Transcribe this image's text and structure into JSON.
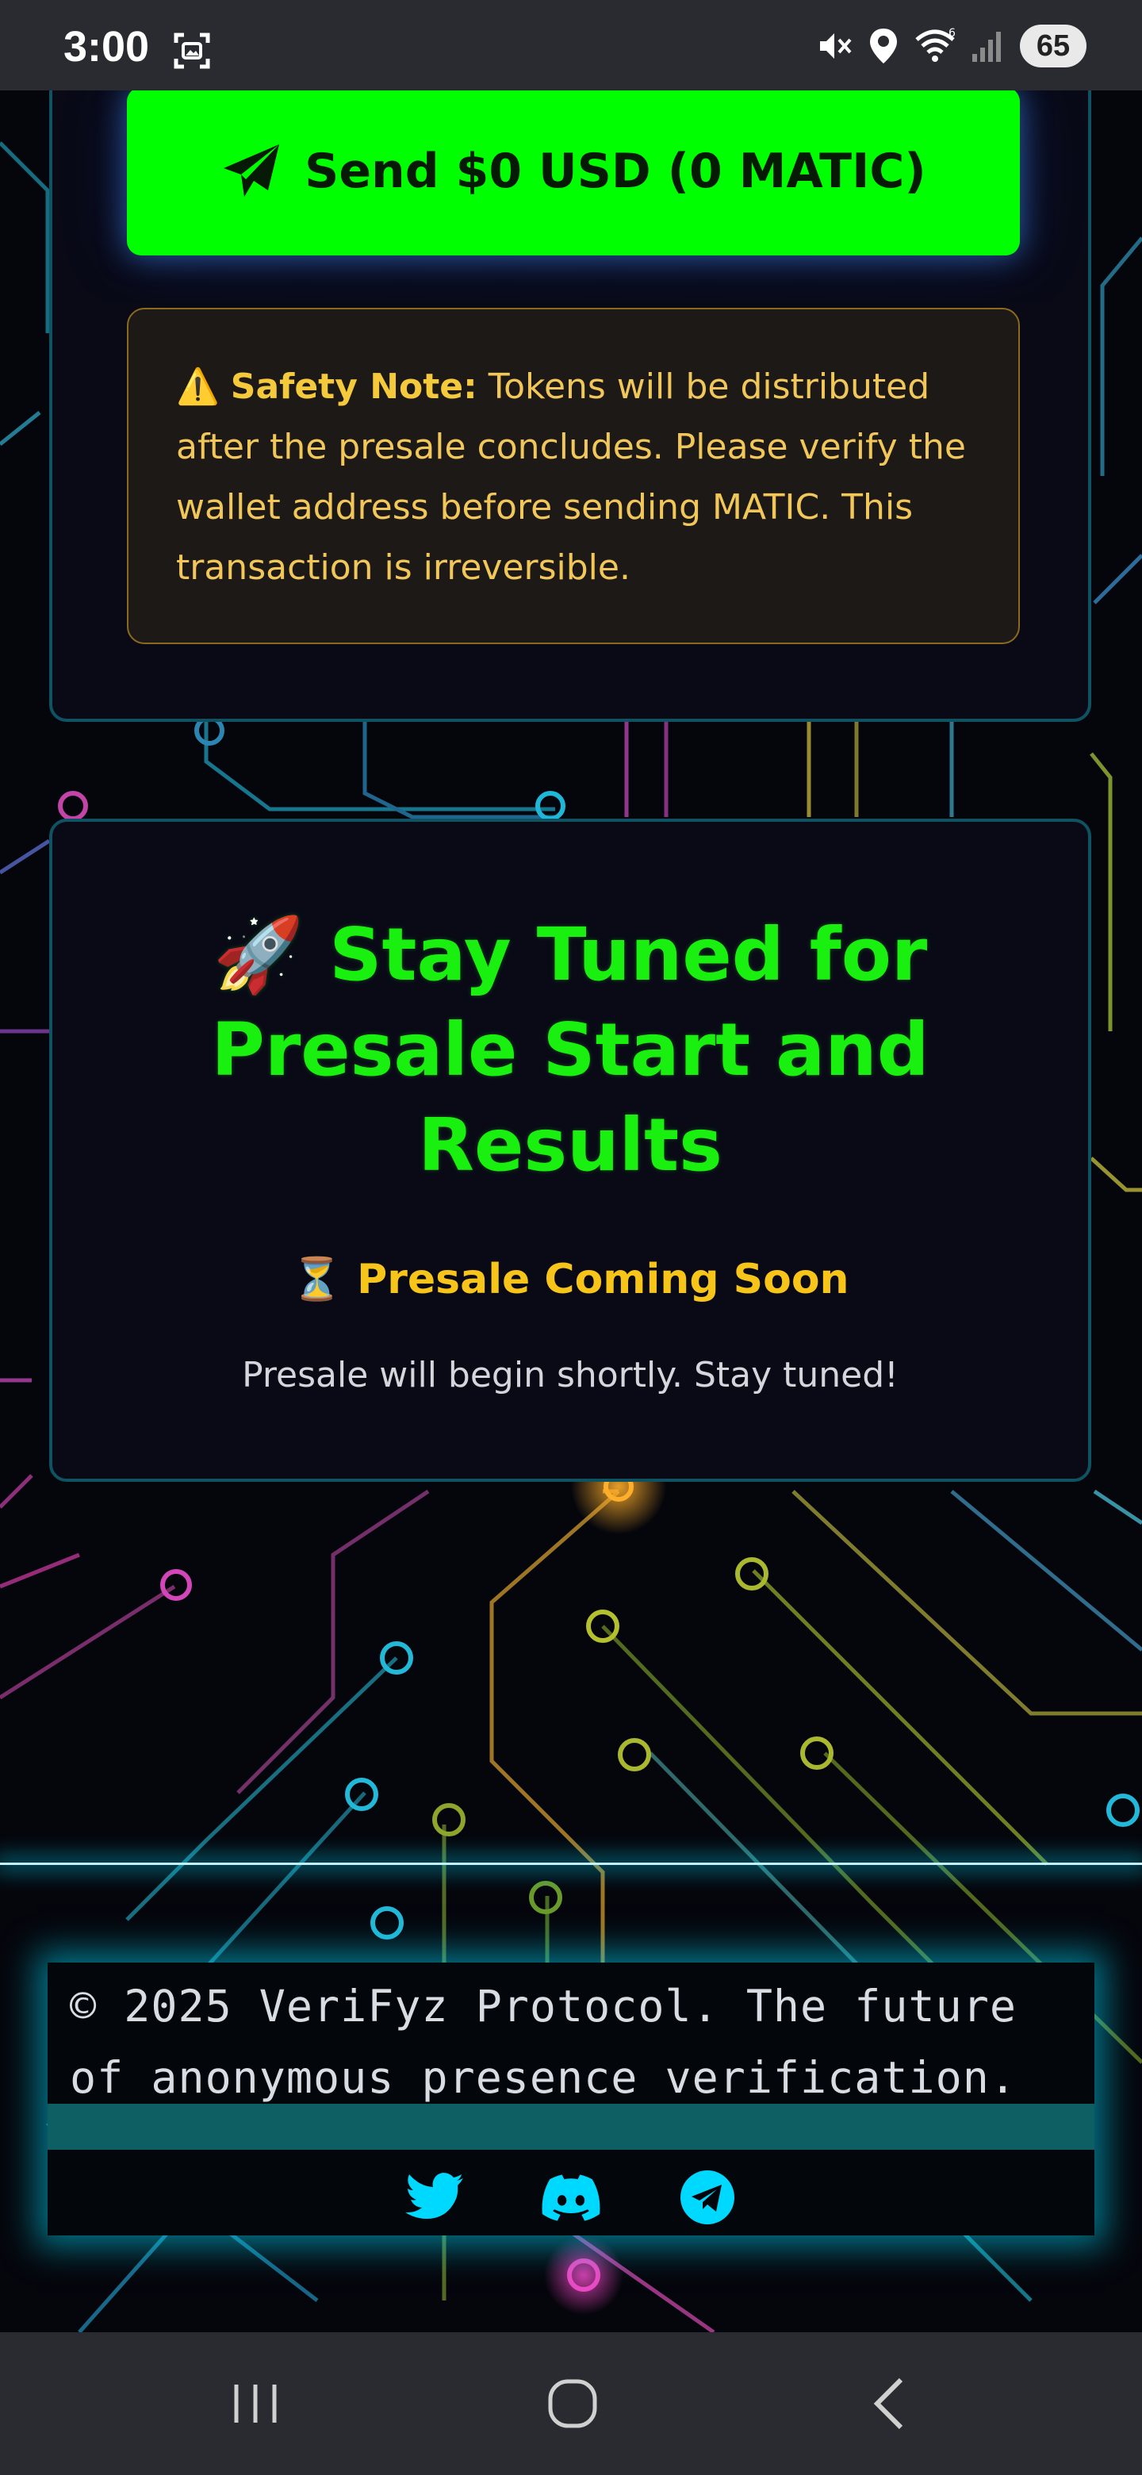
{
  "status_bar": {
    "time": "3:00",
    "battery": "65",
    "icons": [
      "screenshot-icon",
      "mute-icon",
      "location-icon",
      "wifi-icon",
      "signal-icon"
    ]
  },
  "send_button": {
    "label": "Send $0 USD (0 MATIC)",
    "icon": "paper-plane-icon"
  },
  "safety_note": {
    "emoji": "⚠️",
    "label": "Safety Note:",
    "text": " Tokens will be distributed after the presale concludes. Please verify the wallet address before sending MATIC. This transaction is irreversible."
  },
  "presale": {
    "title": "🚀 Stay Tuned for Presale Start and Results",
    "status_emoji": "⏳",
    "status": "Presale Coming Soon",
    "message": "Presale will begin shortly. Stay tuned!"
  },
  "footer": {
    "copyright": "© 2025 VeriFyz Protocol. The future of anonymous presence verification.",
    "social": [
      "twitter-icon",
      "discord-icon",
      "telegram-icon"
    ]
  },
  "nav": {
    "buttons": [
      "recent-apps",
      "home",
      "back"
    ]
  },
  "colors": {
    "accent_green": "#00ff00",
    "title_green": "#19f00f",
    "warning_yellow": "#f5c93c",
    "cyan": "#00e5ff",
    "card_border": "#0f5363"
  }
}
